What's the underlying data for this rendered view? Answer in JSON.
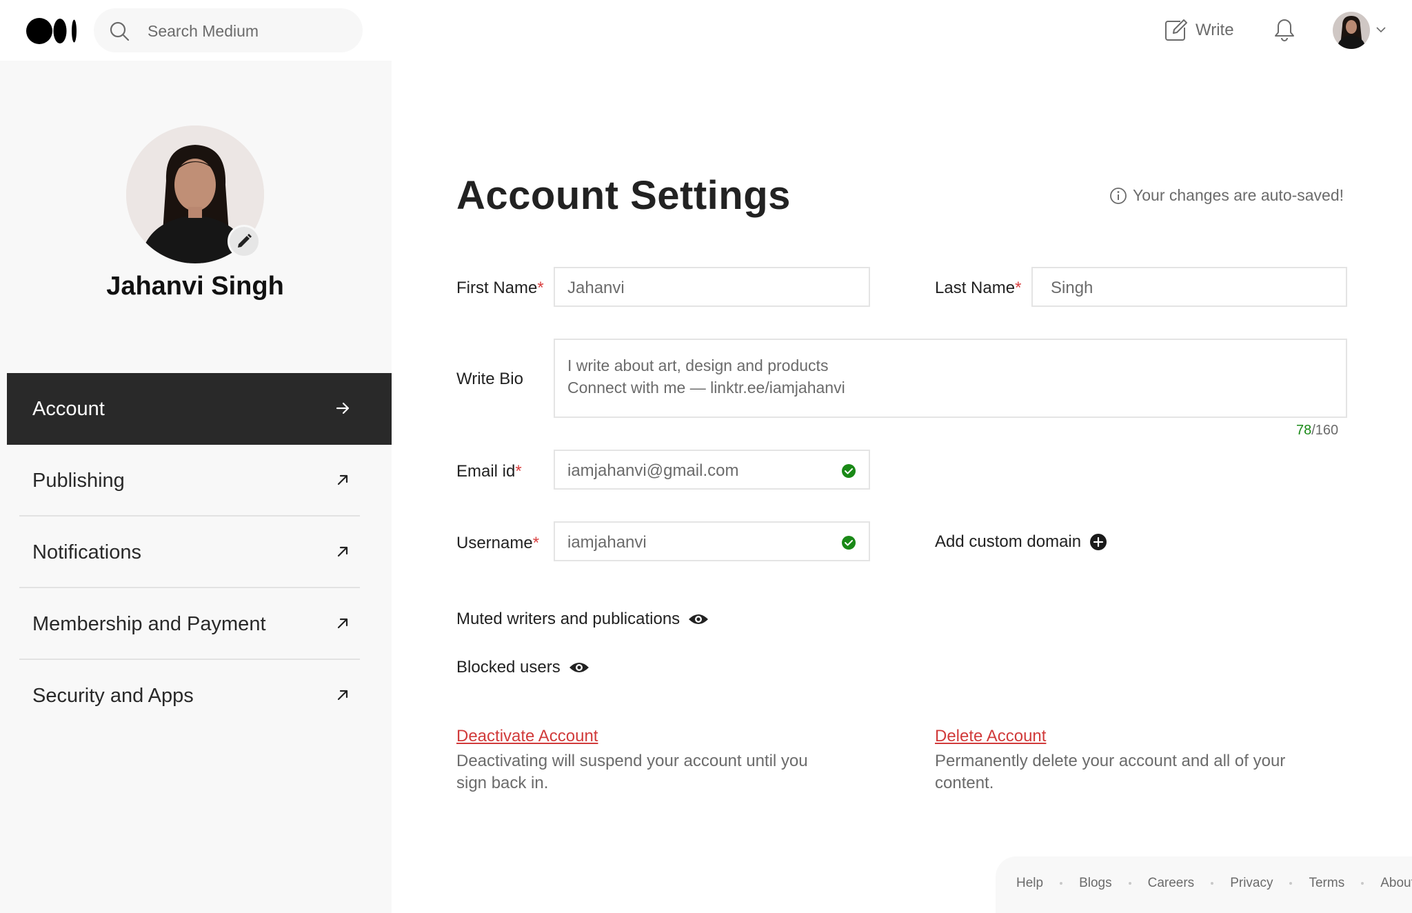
{
  "topbar": {
    "search_placeholder": "Search Medium",
    "write_label": "Write"
  },
  "profile": {
    "name": "Jahanvi Singh"
  },
  "sidebar": {
    "items": [
      {
        "label": "Account",
        "active": true
      },
      {
        "label": "Publishing"
      },
      {
        "label": "Notifications"
      },
      {
        "label": "Membership and Payment"
      },
      {
        "label": "Security and Apps"
      }
    ]
  },
  "main": {
    "title": "Account Settings",
    "autosave_note": "Your changes are auto-saved!",
    "required_mark": "*",
    "first_name": {
      "label": "First Name",
      "value": "Jahanvi"
    },
    "last_name": {
      "label": "Last Name",
      "value": "Singh"
    },
    "bio": {
      "label": "Write Bio",
      "line1": "I write about art, design and products",
      "line2": "Connect with me — linktr.ee/iamjahanvi",
      "count": "78",
      "max": "/160"
    },
    "email": {
      "label": "Email id",
      "value": "iamjahanvi@gmail.com"
    },
    "username": {
      "label": "Username",
      "value": "iamjahanvi"
    },
    "custom_domain_label": "Add custom domain",
    "muted_label": "Muted writers and publications",
    "blocked_label": "Blocked users",
    "deactivate": {
      "link": "Deactivate Account",
      "description": "Deactivating will suspend your account until you sign back in."
    },
    "delete": {
      "link": "Delete Account",
      "description": "Permanently delete your account and all of your content."
    }
  },
  "footer": {
    "links": [
      "Help",
      "Blogs",
      "Careers",
      "Privacy",
      "Terms",
      "About"
    ]
  },
  "colors": {
    "accent_dark": "#292929",
    "required": "#d94040",
    "danger": "#d13b3b",
    "success": "#1a8917"
  },
  "icons": [
    "medium-logo-icon",
    "search-icon",
    "write-icon",
    "bell-icon",
    "chevron-down-icon",
    "pencil-icon",
    "arrow-right-icon",
    "arrow-up-right-icon",
    "info-icon",
    "check-circle-icon",
    "plus-circle-icon",
    "eye-icon"
  ]
}
